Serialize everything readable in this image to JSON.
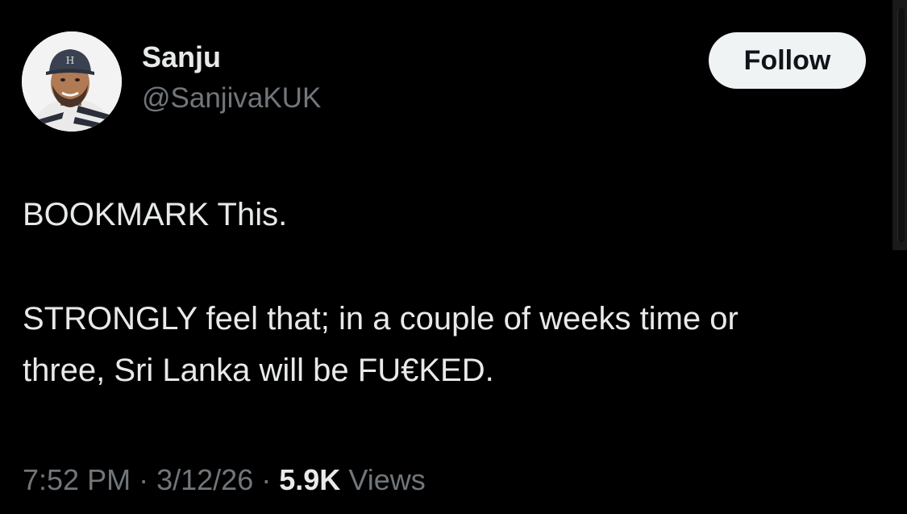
{
  "author": {
    "display_name": "Sanju",
    "handle": "@SanjivaKUK",
    "avatar_icon": "profile-photo"
  },
  "actions": {
    "follow_label": "Follow"
  },
  "tweet": {
    "line_1": "BOOKMARK This.",
    "line_2": "STRONGLY feel that; in a couple of weeks time or",
    "line_3": "three, Sri Lanka will be FU€KED."
  },
  "meta": {
    "time": "7:52 PM",
    "separator": "·",
    "date": "3/12/26",
    "views_count": "5.9K",
    "views_label": "Views"
  },
  "colors": {
    "background": "#000000",
    "primary_text": "#e7e9ea",
    "secondary_text": "#71767b",
    "follow_button_bg": "#eff3f4"
  }
}
